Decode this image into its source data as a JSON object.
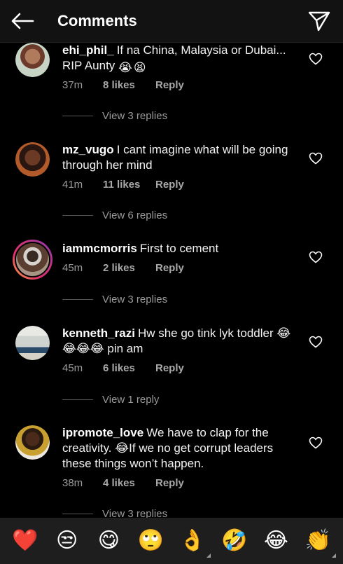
{
  "header": {
    "title": "Comments",
    "back_icon": "arrow-left-icon",
    "send_icon": "paper-plane-icon"
  },
  "comments": [
    {
      "username": "ehi_phil_",
      "text": "If na China, Malaysia or Dubai... RIP Aunty",
      "emojis": [
        "😭",
        "😫"
      ],
      "time": "37m",
      "likes": "8 likes",
      "reply": "Reply",
      "view_replies": "View 3 replies"
    },
    {
      "username": "mz_vugo",
      "text": "I cant imagine what will be going through her mind",
      "time": "41m",
      "likes": "11 likes",
      "reply": "Reply",
      "view_replies": "View 6 replies"
    },
    {
      "username": "iammcmorris",
      "text": "First to cement",
      "time": "45m",
      "likes": "2 likes",
      "reply": "Reply",
      "view_replies": "View 3 replies"
    },
    {
      "username": "kenneth_razi",
      "text_before": "Hw she go tink lyk toddler",
      "emojis": [
        "😂",
        "😂",
        "😂",
        "😂"
      ],
      "text_after": "pin am",
      "time": "45m",
      "likes": "6 likes",
      "reply": "Reply",
      "view_replies": "View 1 reply"
    },
    {
      "username": "ipromote_love",
      "text_before": "We have to clap for the creativity.",
      "emojis": [
        "😂"
      ],
      "text_after": "If we no get corrupt leaders these things won’t happen.",
      "time": "38m",
      "likes": "4 likes",
      "reply": "Reply",
      "view_replies": "View 3 replies"
    }
  ],
  "emoji_bar": [
    "❤️",
    "😒",
    "😋",
    "🙄",
    "👌",
    "🤣",
    "😂",
    "👏"
  ],
  "colors": {
    "background": "#000000",
    "header": "#121212",
    "muted": "#9a9a9a",
    "emoji_bar": "#1e1e1e"
  }
}
